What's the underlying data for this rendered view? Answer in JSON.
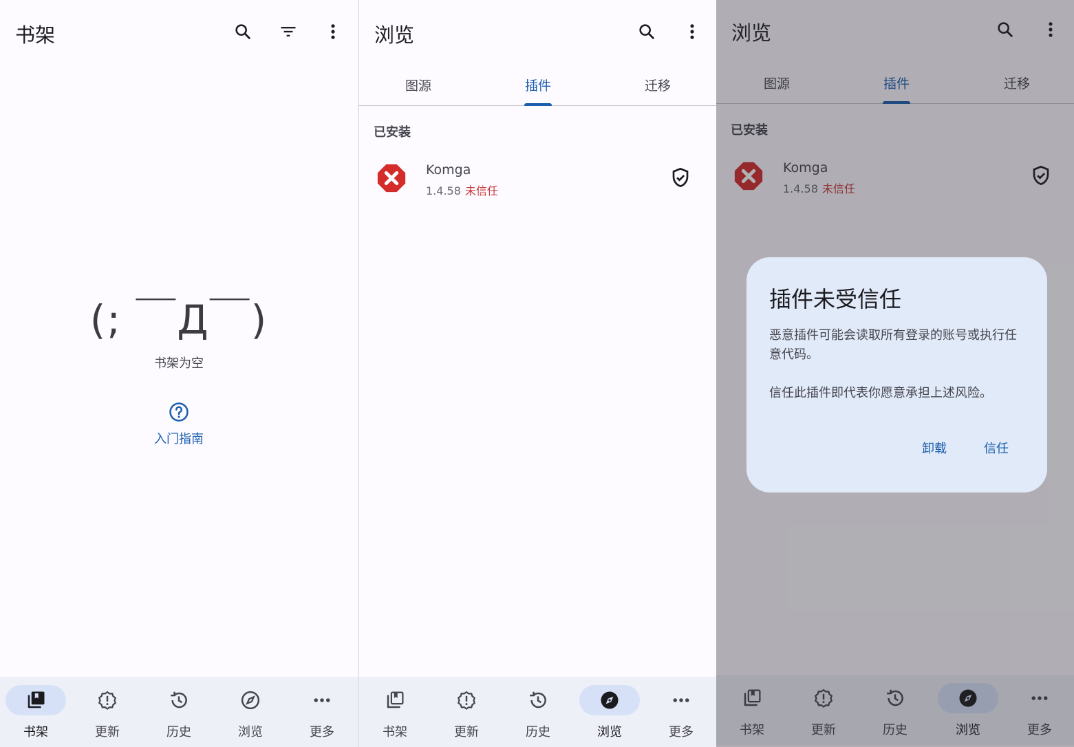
{
  "library": {
    "title": "书架",
    "empty_face": "(; ￣Д￣)",
    "empty_text": "书架为空",
    "guide_label": "入门指南"
  },
  "browse": {
    "title": "浏览",
    "tabs": [
      {
        "label": "图源",
        "active": false
      },
      {
        "label": "插件",
        "active": true
      },
      {
        "label": "迁移",
        "active": false
      }
    ],
    "section_installed": "已安装",
    "extension": {
      "name": "Komga",
      "version": "1.4.58",
      "status": "未信任"
    }
  },
  "dialog": {
    "title": "插件未受信任",
    "body_1": "恶意插件可能会读取所有登录的账号或执行任意代码。",
    "body_2": "信任此插件即代表你愿意承担上述风险。",
    "uninstall_label": "卸载",
    "trust_label": "信任"
  },
  "nav": {
    "library": "书架",
    "updates": "更新",
    "history": "历史",
    "browse": "浏览",
    "more": "更多"
  },
  "icons": [
    "search-icon",
    "filter-icon",
    "more-vert-icon",
    "help-icon",
    "ext-error-icon",
    "shield-check-icon",
    "library-icon",
    "updates-icon",
    "history-icon",
    "explore-icon",
    "more-horiz-icon"
  ],
  "colors": {
    "accent": "#1b5eae",
    "warning": "#c6393b",
    "nav_bg": "#eef0f8",
    "nav_active_pill": "#d6e1f8",
    "dialog_bg": "#e1eaf8",
    "page_bg": "#fdfbff"
  }
}
